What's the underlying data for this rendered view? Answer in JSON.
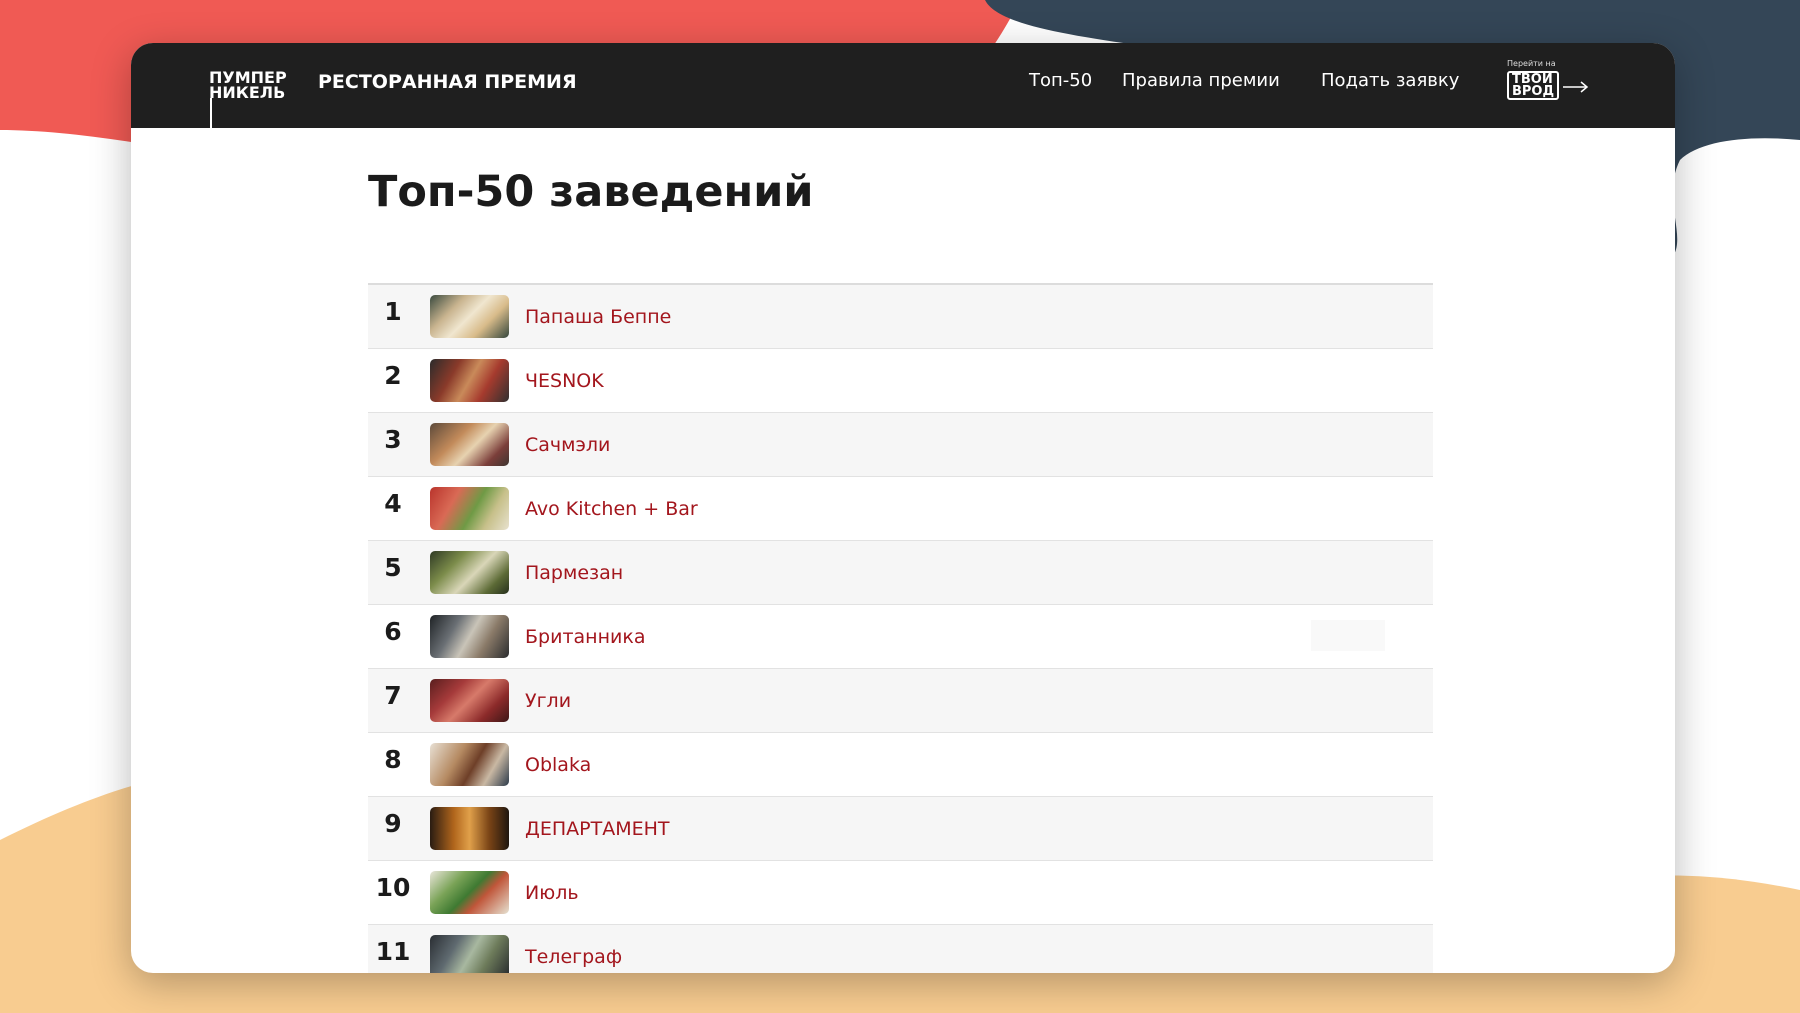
{
  "colors": {
    "accent": "#a3161d",
    "header_bg": "#1f1f1f",
    "bg_red": "#f05a54",
    "bg_navy": "#344657",
    "bg_peach": "#f8cc90"
  },
  "brand": {
    "logo_line1": "ПУМПЕР",
    "logo_line2": "НИКЕЛЬ",
    "title": "РЕСТОРАННАЯ ПРЕМИЯ"
  },
  "nav": {
    "top50": "Топ-50",
    "rules": "Правила премии",
    "apply": "Подать заявку"
  },
  "partner": {
    "caption": "Перейти на",
    "logo_text_1": "ТВОИ",
    "logo_text_2": "ВРОД",
    "icon": "arrow-right-icon"
  },
  "page": {
    "title": "Топ-50 заведений"
  },
  "restaurants": [
    {
      "rank": "1",
      "name": "Папаша Беппе"
    },
    {
      "rank": "2",
      "name": "ЧЕSNOK"
    },
    {
      "rank": "3",
      "name": "Сачмэли"
    },
    {
      "rank": "4",
      "name": "Avo Kitchen + Bar"
    },
    {
      "rank": "5",
      "name": "Пармезан"
    },
    {
      "rank": "6",
      "name": "Британника"
    },
    {
      "rank": "7",
      "name": "Угли"
    },
    {
      "rank": "8",
      "name": "Oblaka"
    },
    {
      "rank": "9",
      "name": "ДЕПАРТАМЕНТ"
    },
    {
      "rank": "10",
      "name": "Июль"
    },
    {
      "rank": "11",
      "name": "Телеграф"
    }
  ]
}
